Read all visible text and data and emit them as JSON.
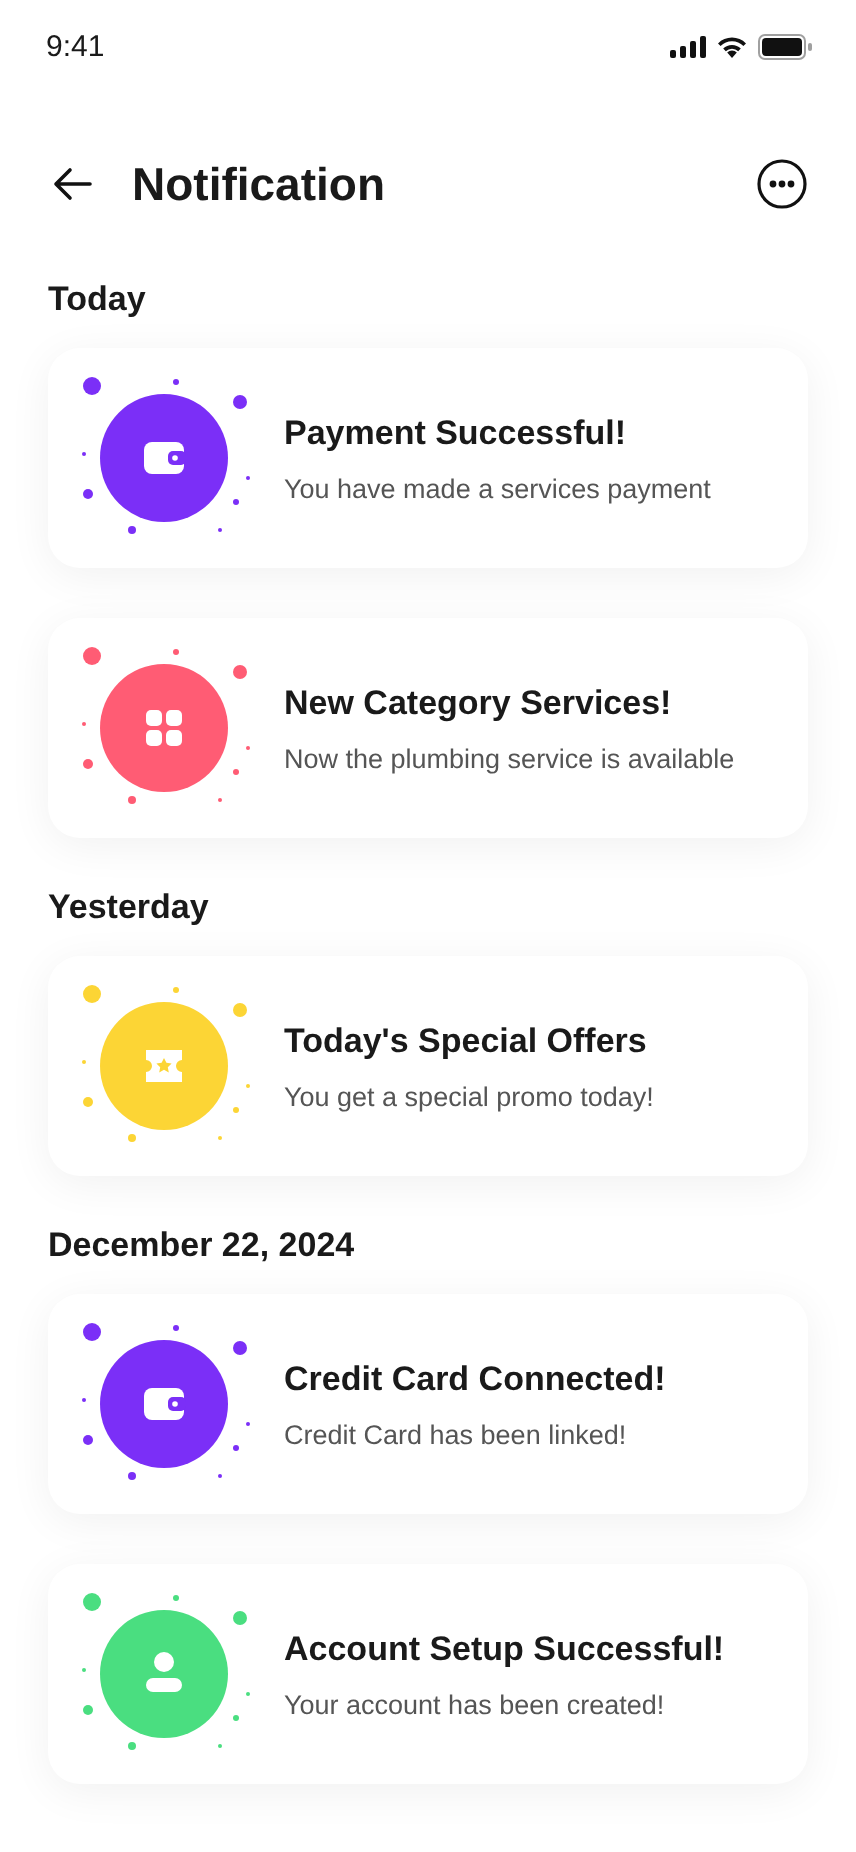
{
  "status_bar": {
    "time": "9:41"
  },
  "header": {
    "title": "Notification"
  },
  "sections": [
    {
      "label": "Today",
      "items": [
        {
          "kind": "wallet",
          "color": "#7b2ff7",
          "title": "Payment Successful!",
          "message": "You have made a services payment"
        },
        {
          "kind": "grid",
          "color": "#ff5c74",
          "title": "New Category Services!",
          "message": "Now the plumbing service is available"
        }
      ]
    },
    {
      "label": "Yesterday",
      "items": [
        {
          "kind": "ticket",
          "color": "#fcd535",
          "title": "Today's Special Offers",
          "message": "You get a special promo today!"
        }
      ]
    },
    {
      "label": "December 22, 2024",
      "items": [
        {
          "kind": "wallet",
          "color": "#7b2ff7",
          "title": "Credit Card Connected!",
          "message": "Credit Card has been linked!"
        },
        {
          "kind": "user",
          "color": "#4ade80",
          "title": "Account Setup Successful!",
          "message": "Your account has been created!"
        }
      ]
    }
  ]
}
